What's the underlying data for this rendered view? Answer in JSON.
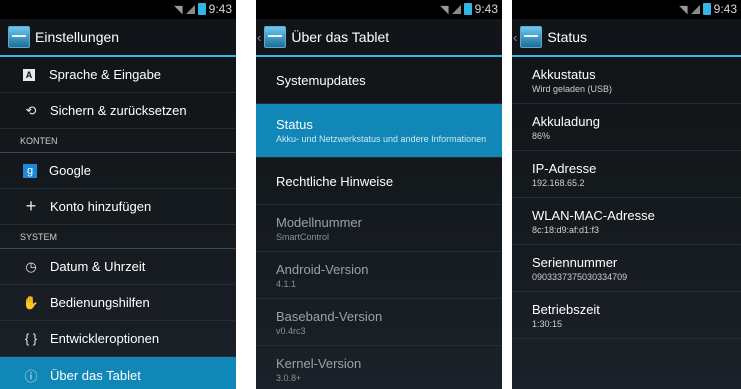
{
  "status_bar": {
    "time": "9:43"
  },
  "screen1": {
    "title": "Einstellungen",
    "rows": [
      {
        "label": "Sprache & Eingabe"
      },
      {
        "label": "Sichern & zurücksetzen"
      }
    ],
    "section_accounts": "KONTEN",
    "accounts": [
      {
        "label": "Google"
      },
      {
        "label": "Konto hinzufügen"
      }
    ],
    "section_system": "SYSTEM",
    "system": [
      {
        "label": "Datum & Uhrzeit"
      },
      {
        "label": "Bedienungshilfen"
      },
      {
        "label": "Entwickleroptionen"
      },
      {
        "label": "Über das Tablet"
      }
    ]
  },
  "screen2": {
    "title": "Über das Tablet",
    "items": [
      {
        "title": "Systemupdates"
      },
      {
        "title": "Status",
        "subtitle": "Akku- und Netzwerkstatus und andere Informationen"
      },
      {
        "title": "Rechtliche Hinweise"
      },
      {
        "title": "Modellnummer",
        "subtitle": "SmartControl"
      },
      {
        "title": "Android-Version",
        "subtitle": "4.1.1"
      },
      {
        "title": "Baseband-Version",
        "subtitle": "v0.4rc3"
      },
      {
        "title": "Kernel-Version",
        "subtitle": "3.0.8+"
      }
    ]
  },
  "screen3": {
    "title": "Status",
    "items": [
      {
        "title": "Akkustatus",
        "subtitle": "Wird geladen (USB)"
      },
      {
        "title": "Akkuladung",
        "subtitle": "86%"
      },
      {
        "title": "IP-Adresse",
        "subtitle": "192.168.65.2"
      },
      {
        "title": "WLAN-MAC-Adresse",
        "subtitle": "8c:18:d9:af:d1:f3"
      },
      {
        "title": "Seriennummer",
        "subtitle": "0903337375030334709"
      },
      {
        "title": "Betriebszeit",
        "subtitle": "1:30:15"
      }
    ]
  },
  "colors": {
    "accent": "#33b5e5",
    "selected": "#1187b7"
  }
}
